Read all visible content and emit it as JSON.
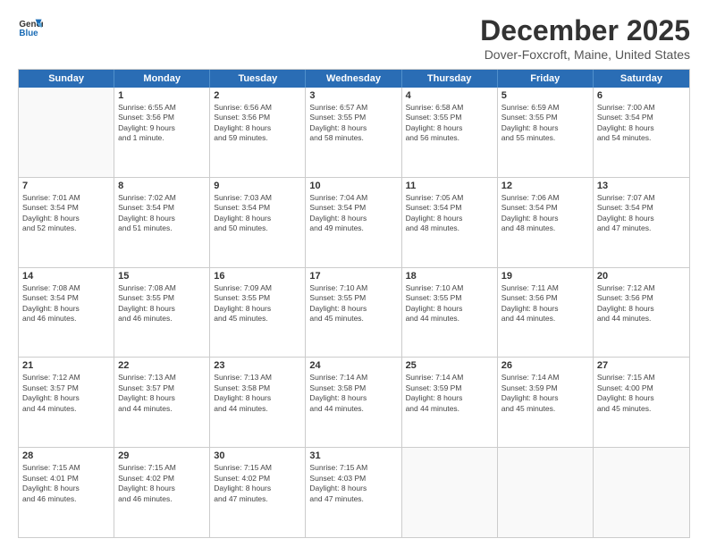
{
  "header": {
    "logo_line1": "General",
    "logo_line2": "Blue",
    "month": "December 2025",
    "location": "Dover-Foxcroft, Maine, United States"
  },
  "days_of_week": [
    "Sunday",
    "Monday",
    "Tuesday",
    "Wednesday",
    "Thursday",
    "Friday",
    "Saturday"
  ],
  "weeks": [
    [
      {
        "day": "",
        "data": "",
        "empty": true
      },
      {
        "day": "1",
        "data": "Sunrise: 6:55 AM\nSunset: 3:56 PM\nDaylight: 9 hours\nand 1 minute."
      },
      {
        "day": "2",
        "data": "Sunrise: 6:56 AM\nSunset: 3:56 PM\nDaylight: 8 hours\nand 59 minutes."
      },
      {
        "day": "3",
        "data": "Sunrise: 6:57 AM\nSunset: 3:55 PM\nDaylight: 8 hours\nand 58 minutes."
      },
      {
        "day": "4",
        "data": "Sunrise: 6:58 AM\nSunset: 3:55 PM\nDaylight: 8 hours\nand 56 minutes."
      },
      {
        "day": "5",
        "data": "Sunrise: 6:59 AM\nSunset: 3:55 PM\nDaylight: 8 hours\nand 55 minutes."
      },
      {
        "day": "6",
        "data": "Sunrise: 7:00 AM\nSunset: 3:54 PM\nDaylight: 8 hours\nand 54 minutes."
      }
    ],
    [
      {
        "day": "7",
        "data": "Sunrise: 7:01 AM\nSunset: 3:54 PM\nDaylight: 8 hours\nand 52 minutes."
      },
      {
        "day": "8",
        "data": "Sunrise: 7:02 AM\nSunset: 3:54 PM\nDaylight: 8 hours\nand 51 minutes."
      },
      {
        "day": "9",
        "data": "Sunrise: 7:03 AM\nSunset: 3:54 PM\nDaylight: 8 hours\nand 50 minutes."
      },
      {
        "day": "10",
        "data": "Sunrise: 7:04 AM\nSunset: 3:54 PM\nDaylight: 8 hours\nand 49 minutes."
      },
      {
        "day": "11",
        "data": "Sunrise: 7:05 AM\nSunset: 3:54 PM\nDaylight: 8 hours\nand 48 minutes."
      },
      {
        "day": "12",
        "data": "Sunrise: 7:06 AM\nSunset: 3:54 PM\nDaylight: 8 hours\nand 48 minutes."
      },
      {
        "day": "13",
        "data": "Sunrise: 7:07 AM\nSunset: 3:54 PM\nDaylight: 8 hours\nand 47 minutes."
      }
    ],
    [
      {
        "day": "14",
        "data": "Sunrise: 7:08 AM\nSunset: 3:54 PM\nDaylight: 8 hours\nand 46 minutes."
      },
      {
        "day": "15",
        "data": "Sunrise: 7:08 AM\nSunset: 3:55 PM\nDaylight: 8 hours\nand 46 minutes."
      },
      {
        "day": "16",
        "data": "Sunrise: 7:09 AM\nSunset: 3:55 PM\nDaylight: 8 hours\nand 45 minutes."
      },
      {
        "day": "17",
        "data": "Sunrise: 7:10 AM\nSunset: 3:55 PM\nDaylight: 8 hours\nand 45 minutes."
      },
      {
        "day": "18",
        "data": "Sunrise: 7:10 AM\nSunset: 3:55 PM\nDaylight: 8 hours\nand 44 minutes."
      },
      {
        "day": "19",
        "data": "Sunrise: 7:11 AM\nSunset: 3:56 PM\nDaylight: 8 hours\nand 44 minutes."
      },
      {
        "day": "20",
        "data": "Sunrise: 7:12 AM\nSunset: 3:56 PM\nDaylight: 8 hours\nand 44 minutes."
      }
    ],
    [
      {
        "day": "21",
        "data": "Sunrise: 7:12 AM\nSunset: 3:57 PM\nDaylight: 8 hours\nand 44 minutes."
      },
      {
        "day": "22",
        "data": "Sunrise: 7:13 AM\nSunset: 3:57 PM\nDaylight: 8 hours\nand 44 minutes."
      },
      {
        "day": "23",
        "data": "Sunrise: 7:13 AM\nSunset: 3:58 PM\nDaylight: 8 hours\nand 44 minutes."
      },
      {
        "day": "24",
        "data": "Sunrise: 7:14 AM\nSunset: 3:58 PM\nDaylight: 8 hours\nand 44 minutes."
      },
      {
        "day": "25",
        "data": "Sunrise: 7:14 AM\nSunset: 3:59 PM\nDaylight: 8 hours\nand 44 minutes."
      },
      {
        "day": "26",
        "data": "Sunrise: 7:14 AM\nSunset: 3:59 PM\nDaylight: 8 hours\nand 45 minutes."
      },
      {
        "day": "27",
        "data": "Sunrise: 7:15 AM\nSunset: 4:00 PM\nDaylight: 8 hours\nand 45 minutes."
      }
    ],
    [
      {
        "day": "28",
        "data": "Sunrise: 7:15 AM\nSunset: 4:01 PM\nDaylight: 8 hours\nand 46 minutes."
      },
      {
        "day": "29",
        "data": "Sunrise: 7:15 AM\nSunset: 4:02 PM\nDaylight: 8 hours\nand 46 minutes."
      },
      {
        "day": "30",
        "data": "Sunrise: 7:15 AM\nSunset: 4:02 PM\nDaylight: 8 hours\nand 47 minutes."
      },
      {
        "day": "31",
        "data": "Sunrise: 7:15 AM\nSunset: 4:03 PM\nDaylight: 8 hours\nand 47 minutes."
      },
      {
        "day": "",
        "data": "",
        "empty": true
      },
      {
        "day": "",
        "data": "",
        "empty": true
      },
      {
        "day": "",
        "data": "",
        "empty": true
      }
    ]
  ]
}
